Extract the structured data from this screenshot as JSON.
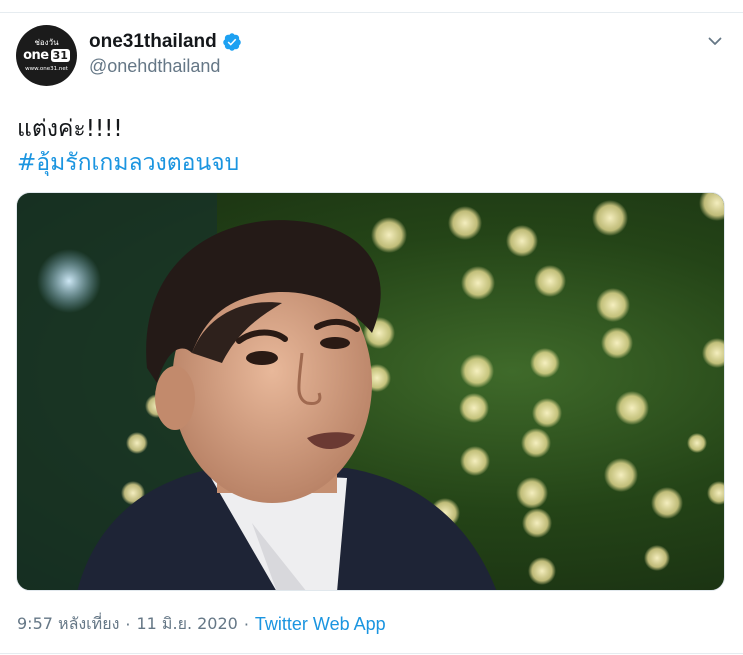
{
  "author": {
    "display_name": "one31thailand",
    "handle": "@onehdthailand",
    "verified": true,
    "avatar": {
      "top_text": "ช่องวัน",
      "logo_text": "one",
      "logo_number": "31",
      "url_text": "www.one31.net"
    }
  },
  "tweet": {
    "text": "แต่งค่ะ!!!!",
    "hashtag": "#อุ้มรักเกมลวงตอนจบ"
  },
  "meta": {
    "time": "9:57 หลังเที่ยง",
    "separator": "·",
    "date": "11 มิ.ย. 2020",
    "source": "Twitter Web App"
  },
  "icons": {
    "verified": "verified-badge-icon",
    "menu": "chevron-down-icon"
  },
  "colors": {
    "link": "#1b95e0",
    "secondary_text": "#657786",
    "primary_text": "#14171a",
    "verified_badge": "#1da1f2"
  }
}
